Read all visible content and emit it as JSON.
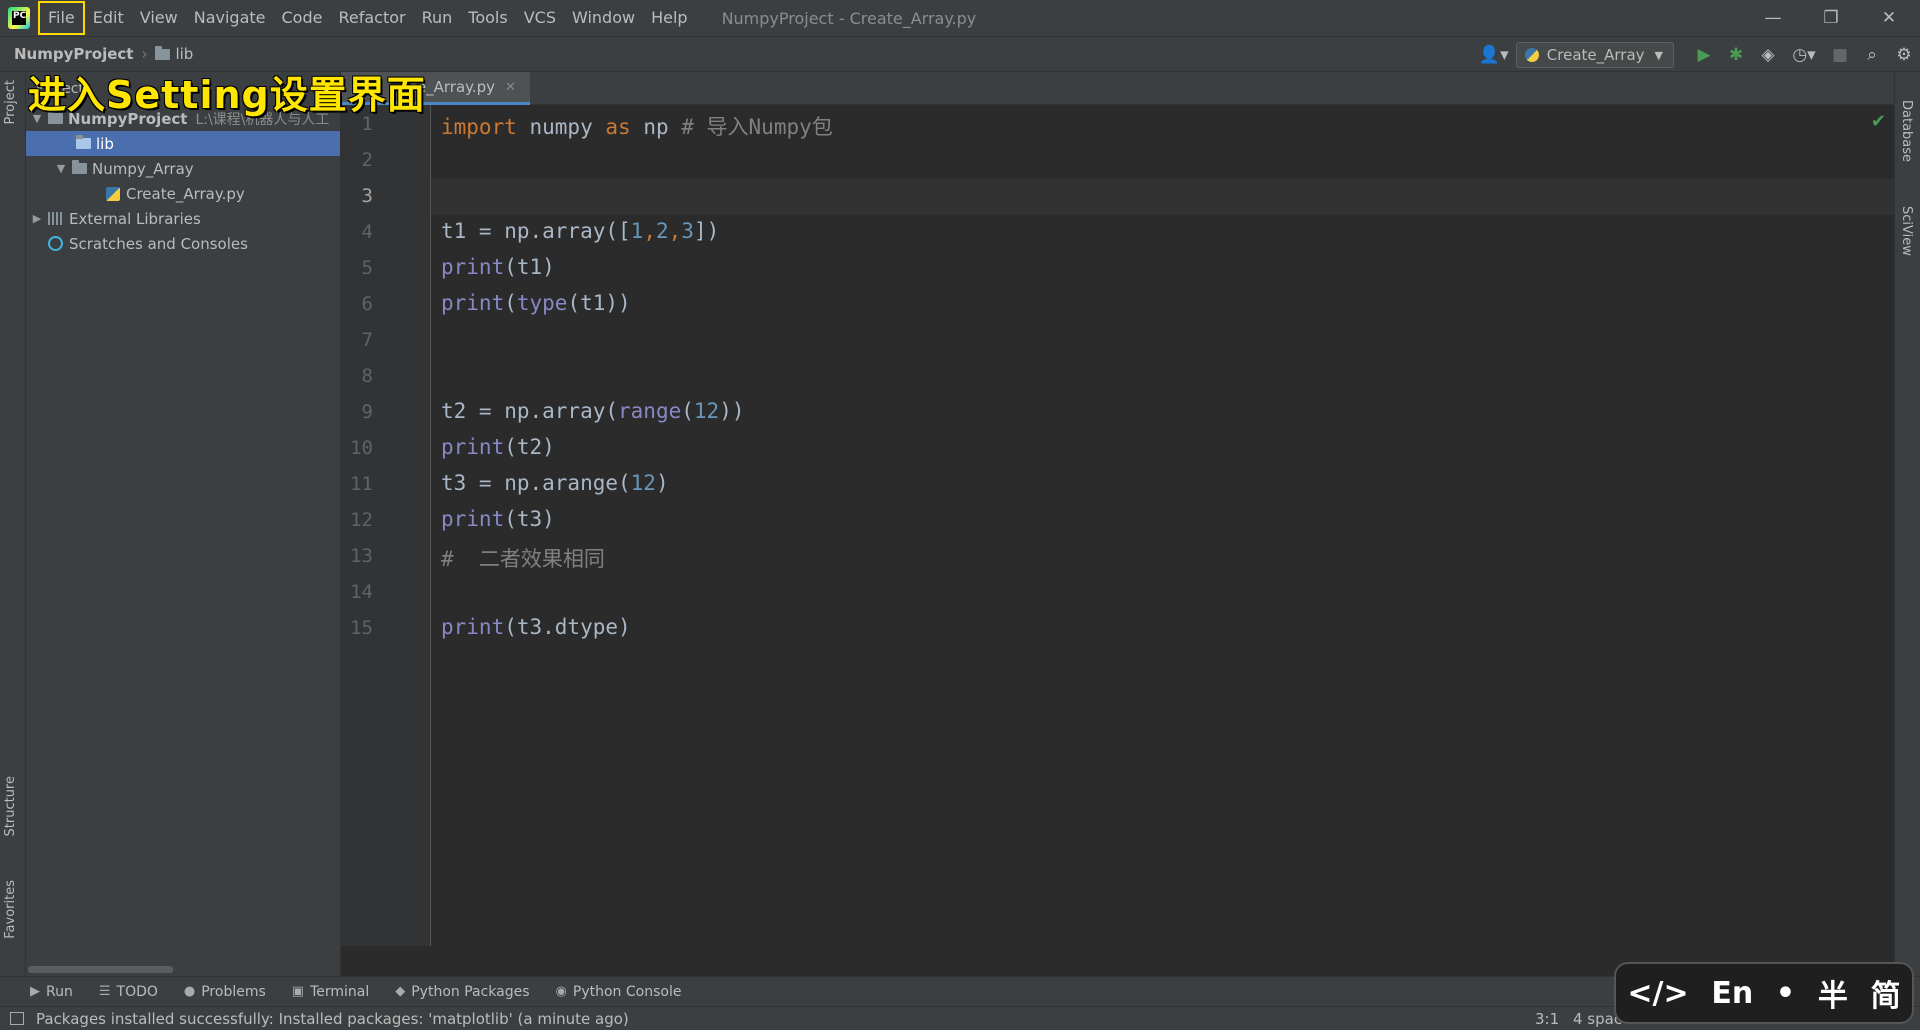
{
  "menu": {
    "items": [
      "File",
      "Edit",
      "View",
      "Navigate",
      "Code",
      "Refactor",
      "Run",
      "Tools",
      "VCS",
      "Window",
      "Help"
    ],
    "highlighted": "File"
  },
  "window_title": "NumpyProject - Create_Array.py",
  "window_controls": {
    "minimize": "—",
    "restore": "❐",
    "close": "✕"
  },
  "breadcrumb": {
    "project": "NumpyProject",
    "folder": "lib"
  },
  "toolbar": {
    "run_config": "Create_Array",
    "icons": [
      "user-icon",
      "run-icon",
      "debug-icon",
      "coverage-icon",
      "profile-icon",
      "stop-icon",
      "search-icon",
      "gear-icon"
    ]
  },
  "overlay_caption": "进入Setting设置界面",
  "project_panel": {
    "header": "Project",
    "tree": {
      "root": {
        "label": "NumpyProject",
        "path": "L:\\课程\\机器人与人工"
      },
      "lib": "lib",
      "numpy_array": "Numpy_Array",
      "file": "Create_Array.py",
      "external": "External Libraries",
      "scratches": "Scratches and Consoles"
    }
  },
  "editor_tab": {
    "label": "Create_Array.py",
    "visible_label": "te_Array.py"
  },
  "editor": {
    "current_line": 3,
    "line_numbers": [
      "1",
      "2",
      "3",
      "4",
      "5",
      "6",
      "7",
      "8",
      "9",
      "10",
      "11",
      "12",
      "13",
      "14",
      "15"
    ],
    "lines": {
      "l1": {
        "kw1": "import",
        "mod": " numpy ",
        "kw2": "as",
        "alias": " np ",
        "comment": "# 导入Numpy包"
      },
      "l4": {
        "a": "t1 = np.array([",
        "n1": "1",
        "c1": ",",
        "n2": "2",
        "c2": ",",
        "n3": "3",
        "b": "])"
      },
      "l5": {
        "fn": "print",
        "rest": "(t1)"
      },
      "l6": {
        "fn": "print",
        "p1": "(",
        "fn2": "type",
        "rest": "(t1))"
      },
      "l9": {
        "a": "t2 = np.array(",
        "fn": "range",
        "p": "(",
        "n": "12",
        "b": "))"
      },
      "l10": {
        "fn": "print",
        "rest": "(t2)"
      },
      "l11": {
        "a": "t3 = np.arange(",
        "n": "12",
        "b": ")"
      },
      "l12": {
        "fn": "print",
        "rest": "(t3)"
      },
      "l13": {
        "comment": "#  二者效果相同"
      },
      "l15": {
        "fn": "print",
        "rest": "(t3.dtype)"
      }
    }
  },
  "left_strip": {
    "project": "Project",
    "structure": "Structure",
    "favorites": "Favorites"
  },
  "right_strip": {
    "database": "Database",
    "sciview": "SciView"
  },
  "bottom_tabs": [
    "Run",
    "TODO",
    "Problems",
    "Terminal",
    "Python Packages",
    "Python Console"
  ],
  "status": {
    "message": "Packages installed successfully: Installed packages: 'matplotlib' (a minute ago)",
    "caret": "3:1",
    "indent": "4 spac"
  },
  "ime": {
    "code": "</>",
    "lang": "En",
    "dot": "•",
    "half": "半",
    "simp": "简"
  }
}
